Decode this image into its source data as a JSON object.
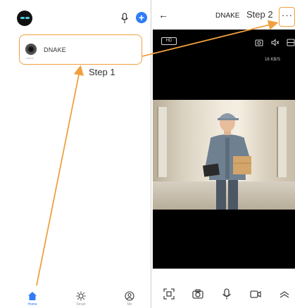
{
  "annotations": {
    "step1": "Step 1",
    "step2": "Step 2",
    "highlight_color": "#f0a040"
  },
  "left_screen": {
    "top_bar": {
      "logo_icon": "owl-logo-icon",
      "mic_icon": "microphone-icon",
      "add_icon": "plus-circle-icon"
    },
    "device": {
      "name": "DNAKE",
      "status": "online",
      "icon": "camera-icon"
    },
    "tabs": [
      {
        "label": "Home",
        "icon": "home-icon",
        "active": true
      },
      {
        "label": "Smart",
        "icon": "sun-icon",
        "active": false
      },
      {
        "label": "Me",
        "icon": "user-circle-icon",
        "active": false
      }
    ]
  },
  "right_screen": {
    "header": {
      "back_icon": "arrow-left-icon",
      "title": "DNAKE",
      "more_label": "···"
    },
    "video": {
      "quality": "HD",
      "speed": "16 KB/S",
      "icons": [
        "snapshot-icon",
        "mute-icon",
        "fullscreen-icon"
      ]
    },
    "controls": [
      "screenshot-icon",
      "camera-icon",
      "microphone-icon",
      "record-icon",
      "expand-up-icon"
    ]
  },
  "colors": {
    "accent": "#2f7cf6",
    "highlight": "#f0a040"
  }
}
